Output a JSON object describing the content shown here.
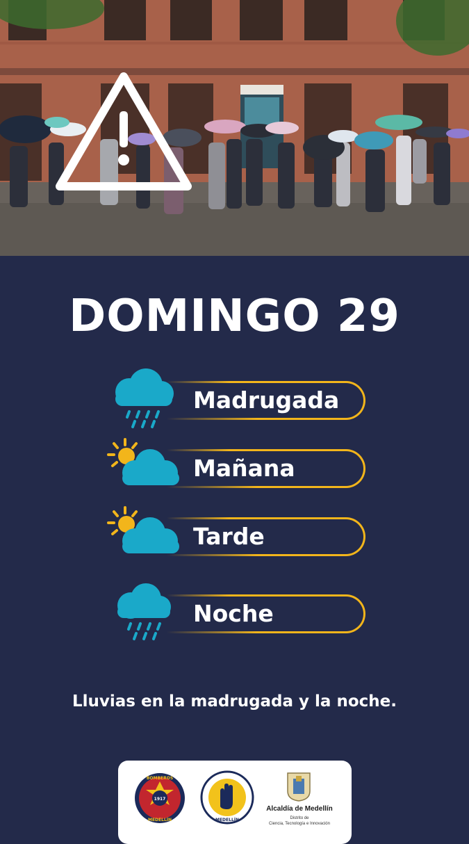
{
  "header": {
    "title": "DOMINGO 29",
    "photo_description_icon": "warning-triangle-icon"
  },
  "forecast": [
    {
      "period": "Madrugada",
      "icon": "cloud-rain-icon"
    },
    {
      "period": "Mañana",
      "icon": "sun-behind-cloud-icon"
    },
    {
      "period": "Tarde",
      "icon": "sun-behind-cloud-icon"
    },
    {
      "period": "Noche",
      "icon": "cloud-rain-icon"
    }
  ],
  "summary": "Lluvias en la madrugada y la noche.",
  "footer": {
    "logo_bomberos": {
      "top": "BOMBEROS",
      "year": "1917",
      "bottom": "MEDELLÍN"
    },
    "logo_dagrd": {
      "bottom": "MEDELLÍN"
    },
    "alcaldia_name": "Alcaldía de Medellín",
    "alcaldia_sub_1": "Distrito de",
    "alcaldia_sub_2": "Ciencia, Tecnología e Innovación"
  },
  "colors": {
    "background": "#232a4a",
    "accent": "#f2b51b",
    "cloud": "#1aa9c9",
    "sun": "#f2b51b",
    "text": "#ffffff"
  }
}
